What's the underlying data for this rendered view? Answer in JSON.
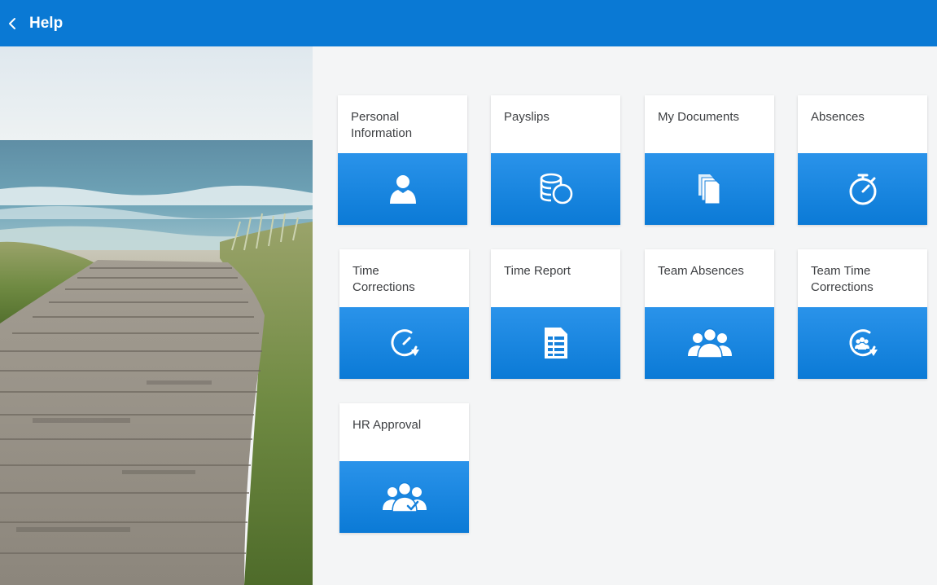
{
  "header": {
    "title": "Help",
    "back_icon": "chevron-left-icon"
  },
  "colors": {
    "header": "#0a79d4",
    "tile_band": "#1586e2",
    "background": "#f4f5f6"
  },
  "hero": {
    "image": "beach-boardwalk-photo"
  },
  "tiles": [
    {
      "label": "Personal\nInformation",
      "icon": "person-icon"
    },
    {
      "label": "Payslips",
      "icon": "coins-icon"
    },
    {
      "label": "My Documents",
      "icon": "documents-icon"
    },
    {
      "label": "Absences",
      "icon": "stopwatch-icon"
    },
    {
      "label": "Time\nCorrections",
      "icon": "clock-refresh-icon"
    },
    {
      "label": "Time Report",
      "icon": "report-sheet-icon"
    },
    {
      "label": "Team Absences",
      "icon": "team-icon"
    },
    {
      "label": "Team Time\nCorrections",
      "icon": "team-clock-refresh-icon"
    },
    {
      "label": "HR Approval",
      "icon": "team-approval-icon"
    }
  ]
}
